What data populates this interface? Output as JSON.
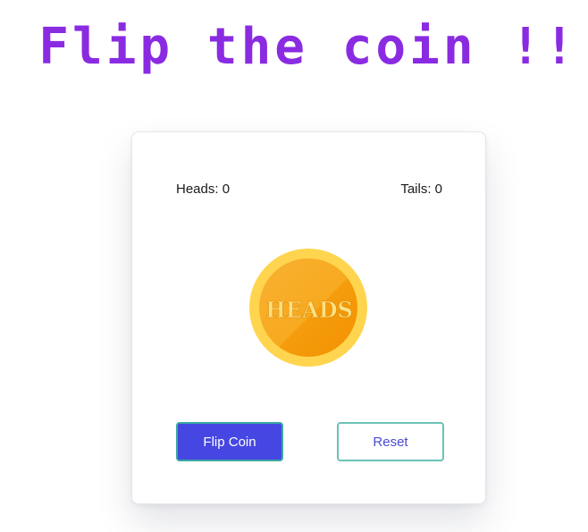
{
  "title": "Flip the coin !!",
  "scoreboard": {
    "heads": "Heads: 0",
    "tails": "Tails: 0"
  },
  "coin": {
    "face_text": "HEADS",
    "face_icon": "coin-heads-icon",
    "colors": {
      "rim": "#ffd54f",
      "face": "#f7a91f",
      "text": "#ffe082"
    }
  },
  "buttons": {
    "flip_label": "Flip Coin",
    "reset_label": "Reset"
  },
  "colors": {
    "title": "#8a2be2",
    "flip_bg": "#4646e3",
    "flip_border": "#3aa8a0",
    "reset_border": "#6ac2b6",
    "reset_text": "#4a4ad0"
  }
}
